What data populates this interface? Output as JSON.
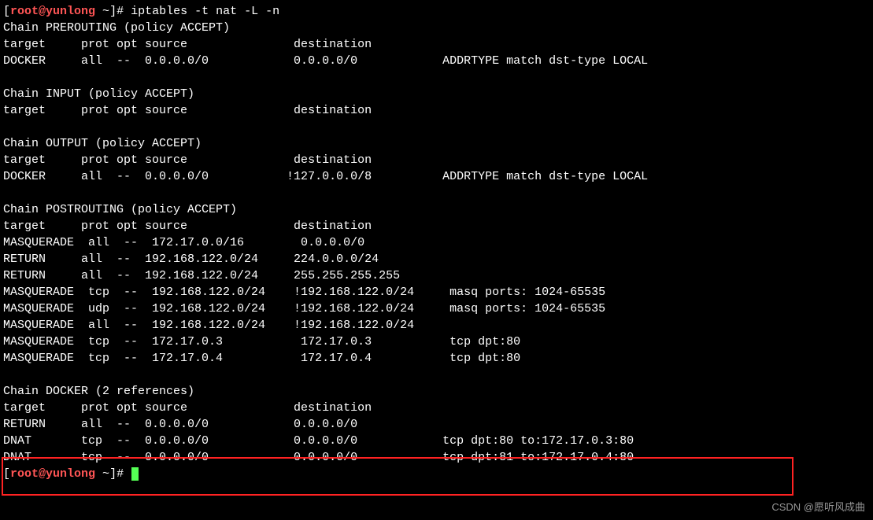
{
  "prompt1": {
    "open": "[",
    "user": "root@yunlong",
    "tilde": " ~",
    "close": "]# ",
    "command": "iptables -t nat -L -n"
  },
  "prerouting": {
    "header": "Chain PREROUTING (policy ACCEPT)",
    "cols": "target     prot opt source               destination         ",
    "rule1": "DOCKER     all  --  0.0.0.0/0            0.0.0.0/0            ADDRTYPE match dst-type LOCAL"
  },
  "input": {
    "header": "Chain INPUT (policy ACCEPT)",
    "cols": "target     prot opt source               destination         "
  },
  "output": {
    "header": "Chain OUTPUT (policy ACCEPT)",
    "cols": "target     prot opt source               destination         ",
    "rule1": "DOCKER     all  --  0.0.0.0/0           !127.0.0.0/8          ADDRTYPE match dst-type LOCAL"
  },
  "postrouting": {
    "header": "Chain POSTROUTING (policy ACCEPT)",
    "cols": "target     prot opt source               destination         ",
    "r1": "MASQUERADE  all  --  172.17.0.0/16        0.0.0.0/0           ",
    "r2": "RETURN     all  --  192.168.122.0/24     224.0.0.0/24        ",
    "r3": "RETURN     all  --  192.168.122.0/24     255.255.255.255     ",
    "r4": "MASQUERADE  tcp  --  192.168.122.0/24    !192.168.122.0/24     masq ports: 1024-65535",
    "r5": "MASQUERADE  udp  --  192.168.122.0/24    !192.168.122.0/24     masq ports: 1024-65535",
    "r6": "MASQUERADE  all  --  192.168.122.0/24    !192.168.122.0/24    ",
    "r7": "MASQUERADE  tcp  --  172.17.0.3           172.17.0.3           tcp dpt:80",
    "r8": "MASQUERADE  tcp  --  172.17.0.4           172.17.0.4           tcp dpt:80"
  },
  "docker": {
    "header": "Chain DOCKER (2 references)",
    "cols": "target     prot opt source               destination         ",
    "r1": "RETURN     all  --  0.0.0.0/0            0.0.0.0/0           ",
    "r2": "DNAT       tcp  --  0.0.0.0/0            0.0.0.0/0            tcp dpt:80 to:172.17.0.3:80",
    "r3": "DNAT       tcp  --  0.0.0.0/0            0.0.0.0/0            tcp dpt:81 to:172.17.0.4:80"
  },
  "prompt2": {
    "open": "[",
    "user": "root@yunlong",
    "tilde": " ~",
    "close": "]# "
  },
  "watermark": "CSDN @愿听风成曲"
}
